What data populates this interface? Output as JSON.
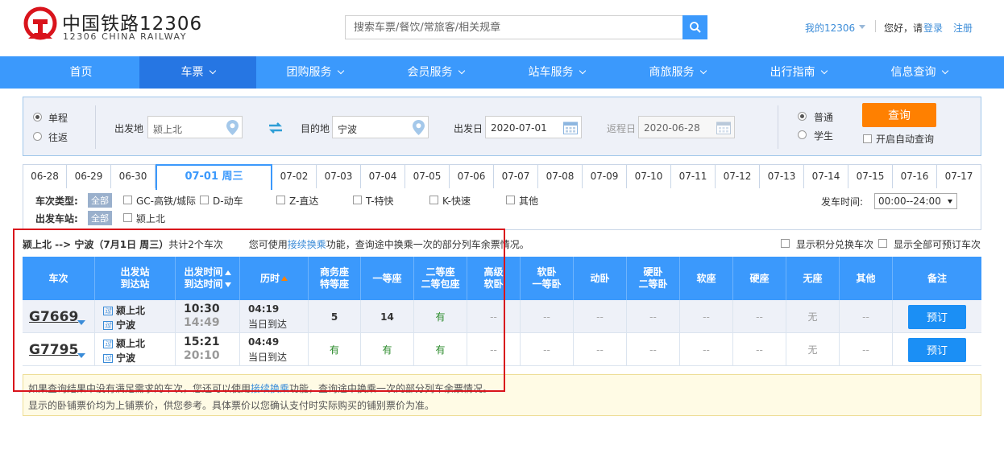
{
  "header": {
    "logo_cn": "中国铁路12306",
    "logo_en": "12306 CHINA RAILWAY",
    "search_placeholder": "搜索车票/餐饮/常旅客/相关规章",
    "my_account": "我的12306",
    "greeting": "您好，请",
    "login": "登录",
    "register": "注册"
  },
  "nav": {
    "items": [
      {
        "label": "首页",
        "has_menu": false,
        "active": false
      },
      {
        "label": "车票",
        "has_menu": true,
        "active": true
      },
      {
        "label": "团购服务",
        "has_menu": true,
        "active": false
      },
      {
        "label": "会员服务",
        "has_menu": true,
        "active": false
      },
      {
        "label": "站车服务",
        "has_menu": true,
        "active": false
      },
      {
        "label": "商旅服务",
        "has_menu": true,
        "active": false
      },
      {
        "label": "出行指南",
        "has_menu": true,
        "active": false
      },
      {
        "label": "信息查询",
        "has_menu": true,
        "active": false
      }
    ]
  },
  "query": {
    "trip_one_way": "单程",
    "trip_round": "往返",
    "from_label": "出发地",
    "from_value": "颍上北",
    "to_label": "目的地",
    "to_value": "宁波",
    "depart_label": "出发日",
    "depart_value": "2020-07-01",
    "return_label": "返程日",
    "return_value": "2020-06-28",
    "ticket_normal": "普通",
    "ticket_student": "学生",
    "query_button": "查询",
    "auto_query": "开启自动查询"
  },
  "date_tabs": [
    "06-28",
    "06-29",
    "06-30",
    "07-01 周三",
    "07-02",
    "07-03",
    "07-04",
    "07-05",
    "07-06",
    "07-07",
    "07-08",
    "07-09",
    "07-10",
    "07-11",
    "07-12",
    "07-13",
    "07-14",
    "07-15",
    "07-16",
    "07-17"
  ],
  "filters": {
    "type_label": "车次类型:",
    "all": "全部",
    "types": [
      "GC-高铁/城际",
      "D-动车",
      "Z-直达",
      "T-特快",
      "K-快速",
      "其他"
    ],
    "station_label": "出发车站:",
    "stations": [
      "颍上北"
    ],
    "time_label": "发车时间:",
    "time_value": "00:00--24:00"
  },
  "summary": {
    "route": "颍上北 --> 宁波（7月1日  周三）",
    "count": "共计2个车次",
    "hint_pre": "您可使用",
    "hint_link": "接续换乘",
    "hint_post": "功能，查询途中换乘一次的部分列车余票情况。",
    "show_points": "显示积分兑换车次",
    "show_bookable": "显示全部可预订车次"
  },
  "table": {
    "headers": {
      "train": "车次",
      "stations_1": "出发站",
      "stations_2": "到达站",
      "time_1": "出发时间",
      "time_2": "到达时间",
      "duration": "历时",
      "business_1": "商务座",
      "business_2": "特等座",
      "first": "一等座",
      "second_1": "二等座",
      "second_2": "二等包座",
      "hsoft_1": "高级",
      "hsoft_2": "软卧",
      "soft_sleeper_1": "软卧",
      "soft_sleeper_2": "一等卧",
      "dongwo": "动卧",
      "hard_sleeper_1": "硬卧",
      "hard_sleeper_2": "二等卧",
      "soft_seat": "软座",
      "hard_seat": "硬座",
      "no_seat": "无座",
      "other": "其他",
      "remark": "备注"
    },
    "rows": [
      {
        "train": "G7669",
        "from": "颍上北",
        "to": "宁波",
        "from_icon": "过",
        "to_icon": "过",
        "dep": "10:30",
        "arr": "14:49",
        "duration": "04:19",
        "arrive_day": "当日到达",
        "business": "5",
        "first": "14",
        "second": "有",
        "hsoft": "--",
        "soft_sleeper": "--",
        "dongwo": "--",
        "hard_sleeper": "--",
        "soft_seat": "--",
        "hard_seat": "--",
        "no_seat": "无",
        "other": "--",
        "book": "预订"
      },
      {
        "train": "G7795",
        "from": "颍上北",
        "to": "宁波",
        "from_icon": "过",
        "to_icon": "过",
        "dep": "15:21",
        "arr": "20:10",
        "duration": "04:49",
        "arrive_day": "当日到达",
        "business": "有",
        "first": "有",
        "second": "有",
        "hsoft": "--",
        "soft_sleeper": "--",
        "dongwo": "--",
        "hard_sleeper": "--",
        "soft_seat": "--",
        "hard_seat": "--",
        "no_seat": "无",
        "other": "--",
        "book": "预订"
      }
    ]
  },
  "notice": {
    "line1_pre": "如果查询结果中没有满足需求的车次，您还可以使用",
    "line1_link": "接续换乘",
    "line1_post": "功能，查询途中换乘一次的部分列车余票情况。",
    "line2": "显示的卧铺票价均为上铺票价，供您参考。具体票价以您确认支付时实际购买的铺别票价为准。"
  },
  "colors": {
    "brand_blue": "#3b99fc",
    "nav_active": "#2676e3",
    "query_orange": "#ff8000",
    "available_green": "#2a8a2a",
    "highlight_red": "#d9141c"
  }
}
